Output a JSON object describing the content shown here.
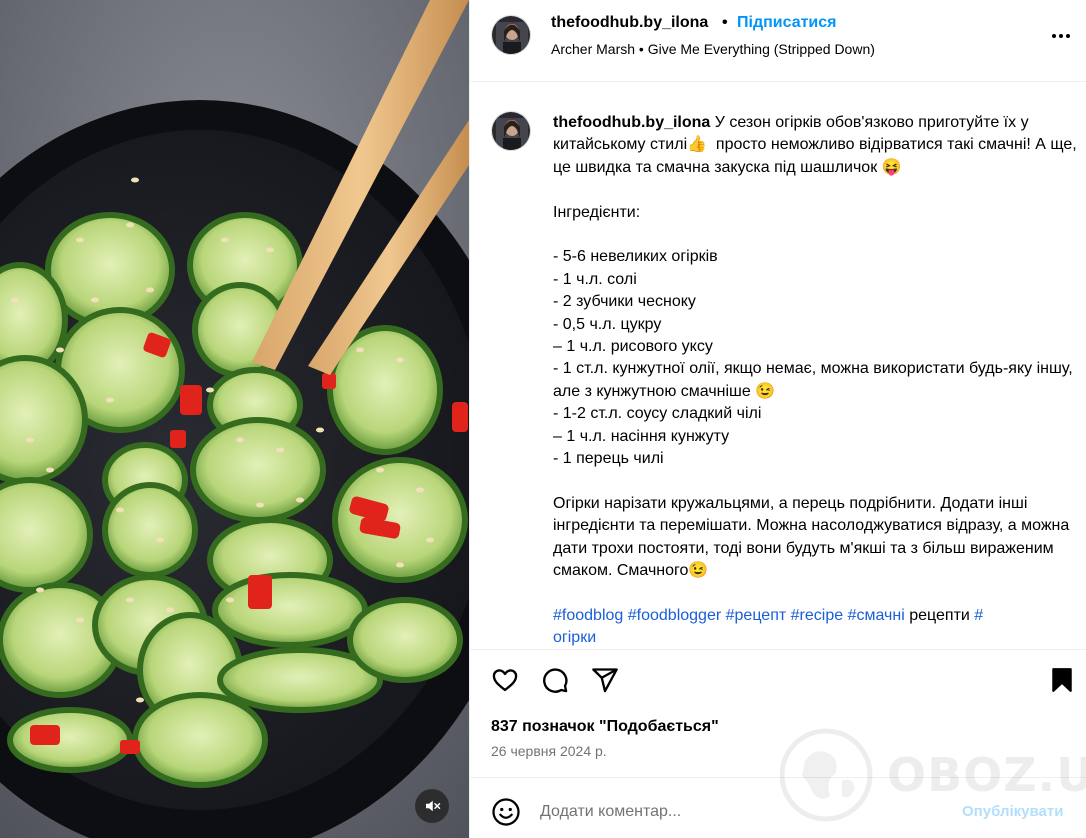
{
  "post": {
    "username": "thefoodhub.by_ilona",
    "separator": "•",
    "follow_label": "Підписатися",
    "audio": "Archer Marsh • Give Me Everything (Stripped Down)",
    "more_icon": "more-horizontal-icon"
  },
  "caption": {
    "username": "thefoodhub.by_ilona",
    "body": " У сезон огірків обов'язково приготуйте їх у китайському стилі👍  просто неможливо відірватися такі смачні! А ще, це швидка та смачна закуска під шашличок 😝\n\nІнгредієнти:\n\n- 5-6 невеликих огірків\n- 1 ч.л. солі\n- 2 зубчики чесноку\n- 0,5 ч.л. цукру\n– 1 ч.л. рисового уксу\n- 1 ст.л. кунжутної олії, якщо немає, можна використати будь-яку іншу, але з кунжутною смачніше 😉\n- 1-2 ст.л. соусу сладкий чілі\n– 1 ч.л. насіння кунжуту\n- 1 перець чилі\n\nОгірки нарізати кружальцями, а перець подрібнити. Додати інші інгредієнти та перемішати. Можна насолоджуватися відразу, а можна дати трохи постояти, тоді вони будуть м'якші та з більш вираженим смаком. Смачного😉\n\n",
    "tags": [
      "#foodblog",
      "#foodblogger",
      "#рецепт",
      "#recipe",
      "#смачні"
    ],
    "plain_word": "рецепти",
    "tag_tail": "#",
    "tag_last": "огірки"
  },
  "actions": {
    "like_icon": "heart-icon",
    "comment_icon": "comment-icon",
    "share_icon": "share-icon",
    "save_icon": "bookmark-icon"
  },
  "likes_text": "837 позначок \"Подобається\"",
  "date": "26 червня 2024 р.",
  "comment": {
    "placeholder": "Додати коментар...",
    "publish_label": "Опублікувати",
    "emoji_icon": "emoji-icon"
  },
  "media": {
    "mute_icon": "speaker-muted-icon"
  },
  "watermark": {
    "text": "OBOZ.UA"
  },
  "colors": {
    "follow": "#0095f6",
    "hashtag": "#1b5fd6",
    "publish_disabled": "#b2dffc",
    "muted_text": "#737373"
  }
}
